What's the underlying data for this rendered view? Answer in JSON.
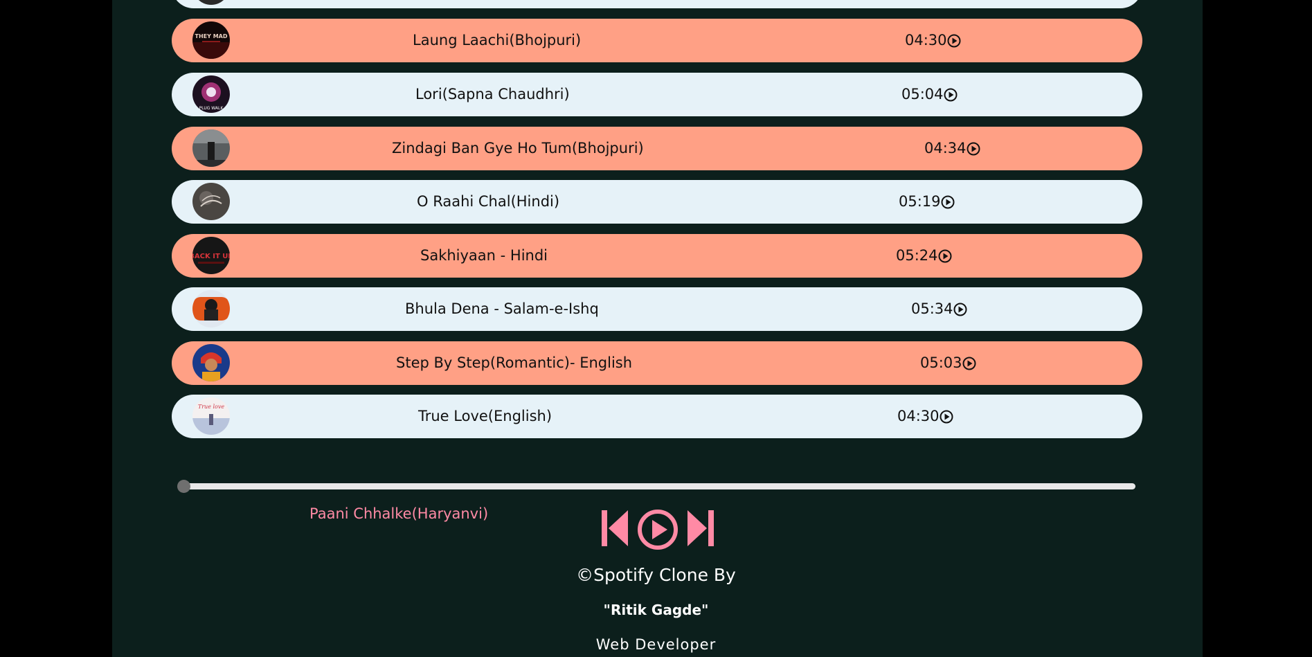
{
  "songs": [
    {
      "title": "Laung Laachi(Bhojpuri)",
      "duration": "04:30",
      "style": "orange"
    },
    {
      "title": "Lori(Sapna Chaudhri)",
      "duration": "05:04",
      "style": "light"
    },
    {
      "title": "Zindagi Ban Gye Ho Tum(Bhojpuri)",
      "duration": "04:34",
      "style": "orange"
    },
    {
      "title": "O Raahi Chal(Hindi)",
      "duration": "05:19",
      "style": "light"
    },
    {
      "title": "Sakhiyaan - Hindi",
      "duration": "05:24",
      "style": "orange"
    },
    {
      "title": "Bhula Dena - Salam-e-Ishq",
      "duration": "05:34",
      "style": "light"
    },
    {
      "title": "Step By Step(Romantic)- English",
      "duration": "05:03",
      "style": "orange"
    },
    {
      "title": "True Love(English)",
      "duration": "04:30",
      "style": "light"
    }
  ],
  "player": {
    "now_playing": "Paani Chhalke(Haryanvi)",
    "progress_percent": 0,
    "controls": [
      "previous-icon",
      "play-circle-icon",
      "next-icon"
    ]
  },
  "footer": {
    "copyright": "©Spotify Clone By",
    "author": "\"Ritik Gagde\"",
    "role": "Web Developer"
  },
  "colors": {
    "background": "#0c1f1c",
    "row_orange": "#ffa085",
    "row_light": "#e6f2f8",
    "accent_pink": "#ff8aa5"
  }
}
